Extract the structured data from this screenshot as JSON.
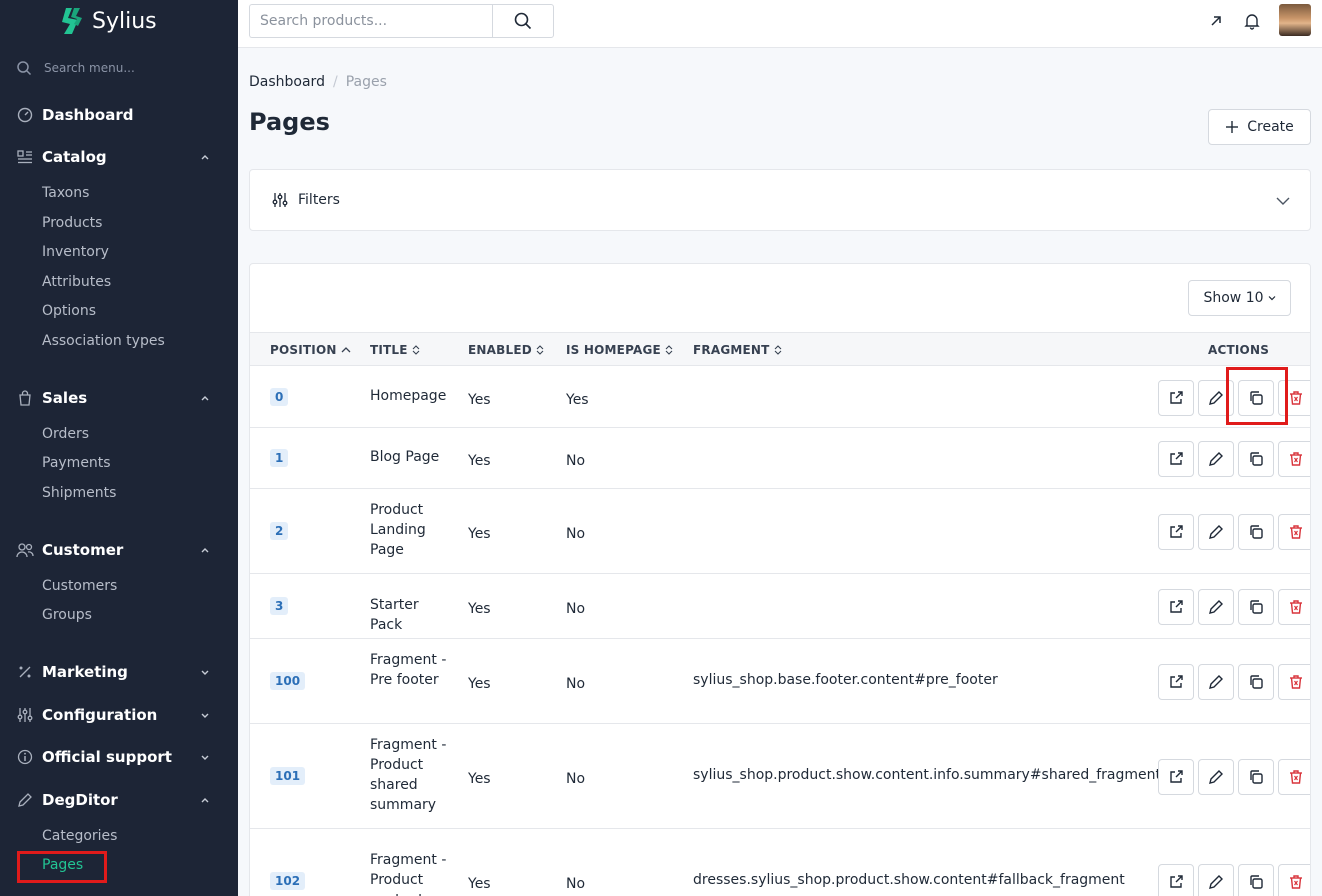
{
  "app": {
    "name": "Sylius"
  },
  "sidebar": {
    "search_placeholder": "Search menu...",
    "dashboard": "Dashboard",
    "catalog": {
      "title": "Catalog",
      "items": [
        "Taxons",
        "Products",
        "Inventory",
        "Attributes",
        "Options",
        "Association types"
      ]
    },
    "sales": {
      "title": "Sales",
      "items": [
        "Orders",
        "Payments",
        "Shipments"
      ]
    },
    "customer": {
      "title": "Customer",
      "items": [
        "Customers",
        "Groups"
      ]
    },
    "marketing": "Marketing",
    "configuration": "Configuration",
    "official_support": "Official support",
    "degditor": {
      "title": "DegDitor",
      "items": [
        "Categories",
        "Pages"
      ]
    }
  },
  "topbar": {
    "search_placeholder": "Search products..."
  },
  "breadcrumb": {
    "home": "Dashboard",
    "separator": "/",
    "current": "Pages"
  },
  "page": {
    "title": "Pages",
    "create_label": "Create"
  },
  "filters": {
    "label": "Filters"
  },
  "table": {
    "show_label": "Show 10",
    "columns": {
      "position": "POSITION",
      "title": "TITLE",
      "enabled": "ENABLED",
      "is_homepage": "IS HOMEPAGE",
      "fragment": "FRAGMENT",
      "actions": "ACTIONS"
    },
    "rows": [
      {
        "position": "0",
        "title": "Homepage",
        "enabled": "Yes",
        "is_homepage": "Yes",
        "fragment": ""
      },
      {
        "position": "1",
        "title": "Blog Page",
        "enabled": "Yes",
        "is_homepage": "No",
        "fragment": ""
      },
      {
        "position": "2",
        "title": "Product Landing Page",
        "enabled": "Yes",
        "is_homepage": "No",
        "fragment": ""
      },
      {
        "position": "3",
        "title": "Starter Pack",
        "enabled": "Yes",
        "is_homepage": "No",
        "fragment": ""
      },
      {
        "position": "100",
        "title": "Fragment - Pre footer",
        "enabled": "Yes",
        "is_homepage": "No",
        "fragment": "sylius_shop.base.footer.content#pre_footer"
      },
      {
        "position": "101",
        "title": "Fragment - Product shared summary",
        "enabled": "Yes",
        "is_homepage": "No",
        "fragment": "sylius_shop.product.show.content.info.summary#shared_fragment"
      },
      {
        "position": "102",
        "title": "Fragment - Product content",
        "enabled": "Yes",
        "is_homepage": "No",
        "fragment": "dresses.sylius_shop.product.show.content#fallback_fragment"
      }
    ]
  },
  "colors": {
    "sidebar_bg": "#1d2536",
    "accent": "#22c493",
    "highlight": "#e01b1b",
    "badge_bg": "#e3eefa",
    "badge_text": "#2c6fb7",
    "delete": "#d9343b"
  }
}
